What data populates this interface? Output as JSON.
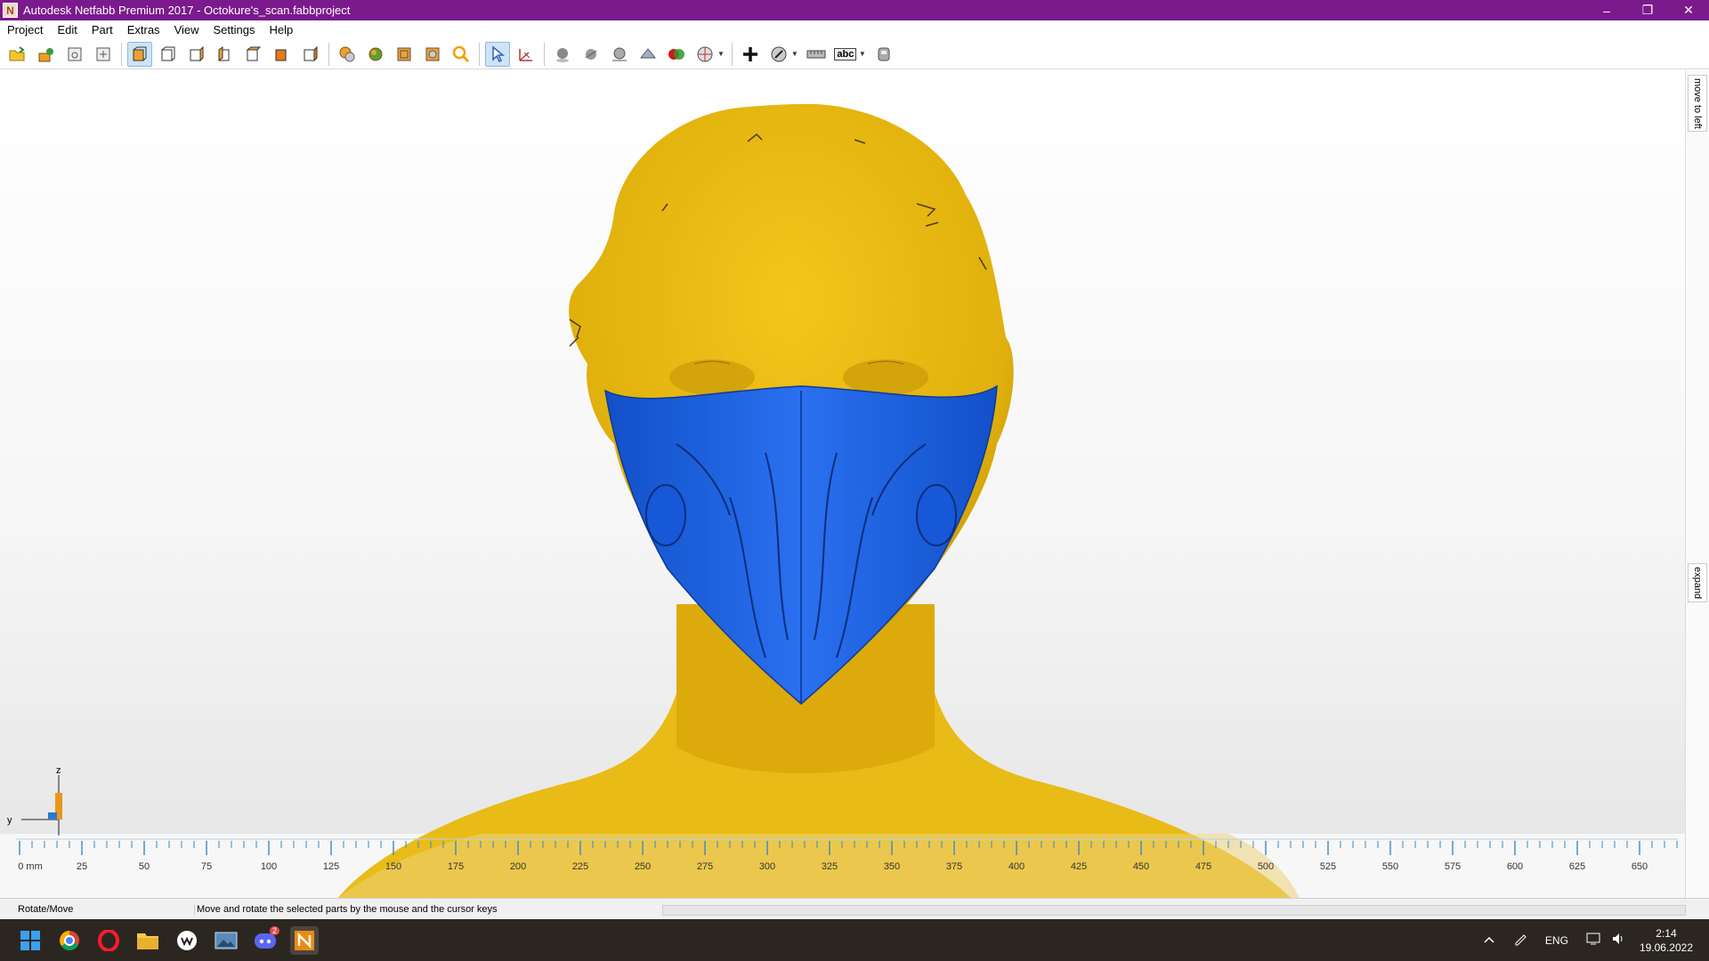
{
  "window": {
    "title": "Autodesk Netfabb Premium 2017 - Octokure's_scan.fabbproject",
    "logo_letter": "N",
    "minimize": "–",
    "restore": "❐",
    "close": "✕"
  },
  "menu": [
    "Project",
    "Edit",
    "Part",
    "Extras",
    "View",
    "Settings",
    "Help"
  ],
  "toolbar_icons": [
    "open-project-icon",
    "add-part-icon",
    "import-icon",
    "export-icon",
    "view-front-icon",
    "view-back-icon",
    "view-left-icon",
    "view-right-icon",
    "view-top-icon",
    "view-bottom-icon",
    "view-iso-icon",
    "zoom-all-icon",
    "zoom-selection-icon",
    "zoom-platform-icon",
    "zoom-window-icon",
    "zoom-icon",
    "select-icon",
    "rotate-move-icon",
    "shading-icon",
    "smooth-icon",
    "wireframe-icon",
    "section-icon",
    "colors-icon",
    "render-mode-icon",
    "add-marker-icon",
    "measure-mode-icon",
    "ruler-icon",
    "label-icon",
    "settings-view-icon"
  ],
  "toolbar": {
    "label_text": "abc"
  },
  "side_tabs": {
    "move_to_left": "move to left",
    "expand": "expand"
  },
  "axis": {
    "z": "z",
    "y": "y"
  },
  "ruler": {
    "unit_first": "0 mm",
    "labels": [
      "25",
      "50",
      "75",
      "100",
      "125",
      "150",
      "175",
      "200",
      "225",
      "250",
      "275",
      "300",
      "325",
      "350",
      "375",
      "400",
      "425",
      "450",
      "475",
      "500",
      "525",
      "550",
      "575",
      "600",
      "625",
      "650"
    ]
  },
  "colors": {
    "title_bar": "#7b1a8c",
    "scan": "#e8b80c",
    "mask": "#1a62e0"
  },
  "status": {
    "mode": "Rotate/Move",
    "message": "Move and rotate the selected parts by the mouse and the cursor keys"
  },
  "taskbar": {
    "apps": [
      "start-icon",
      "chrome-icon",
      "opera-icon",
      "file-explorer-icon",
      "wacom-icon",
      "photos-icon",
      "discord-icon",
      "netfabb-icon"
    ],
    "discord_badge": "2",
    "language": "ENG",
    "time": "2:14",
    "date": "19.06.2022"
  }
}
